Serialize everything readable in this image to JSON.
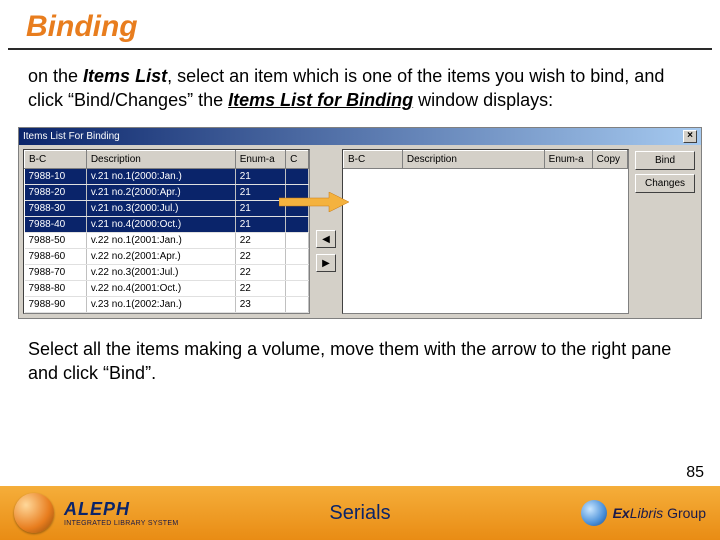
{
  "title": "Binding",
  "para1": {
    "pre": "on the ",
    "items_list": "Items List",
    "mid1": ", select an item which is one of the items you wish to bind, and click ",
    "quoted": "“Bind/Changes”",
    "mid2": " the ",
    "ilfb": "Items List for Binding",
    "tail": " window displays:"
  },
  "window": {
    "title": "Items List For Binding",
    "close": "×",
    "headers": {
      "bc": "B-C",
      "desc": "Description",
      "enum": "Enum-a",
      "c": "C",
      "copy": "Copy"
    },
    "left_rows": [
      {
        "bc": "7988-10",
        "desc": "v.21 no.1(2000:Jan.)",
        "enum": "21",
        "sel": true
      },
      {
        "bc": "7988-20",
        "desc": "v.21 no.2(2000:Apr.)",
        "enum": "21",
        "sel": true
      },
      {
        "bc": "7988-30",
        "desc": "v.21 no.3(2000:Jul.)",
        "enum": "21",
        "sel": true
      },
      {
        "bc": "7988-40",
        "desc": "v.21 no.4(2000:Oct.)",
        "enum": "21",
        "sel": true
      },
      {
        "bc": "7988-50",
        "desc": "v.22 no.1(2001:Jan.)",
        "enum": "22",
        "sel": false
      },
      {
        "bc": "7988-60",
        "desc": "v.22 no.2(2001:Apr.)",
        "enum": "22",
        "sel": false
      },
      {
        "bc": "7988-70",
        "desc": "v.22 no.3(2001:Jul.)",
        "enum": "22",
        "sel": false
      },
      {
        "bc": "7988-80",
        "desc": "v.22 no.4(2001:Oct.)",
        "enum": "22",
        "sel": false
      },
      {
        "bc": "7988-90",
        "desc": "v.23 no.1(2002:Jan.)",
        "enum": "23",
        "sel": false
      }
    ],
    "buttons": {
      "bind": "Bind",
      "changes": "Changes"
    },
    "move_right": "▶",
    "move_left": "◀"
  },
  "para2": {
    "pre": "Select all the items making a volume, move them with the arrow to the right pane and click ",
    "quoted": "“Bind”",
    "tail": "."
  },
  "page_num": "85",
  "footer": {
    "aleph": "ALEPH",
    "aleph_sub": "INTEGRATED LIBRARY SYSTEM",
    "section": "Serials",
    "ex1": "Ex",
    "ex2": "Libris",
    "ex3": "Group"
  }
}
